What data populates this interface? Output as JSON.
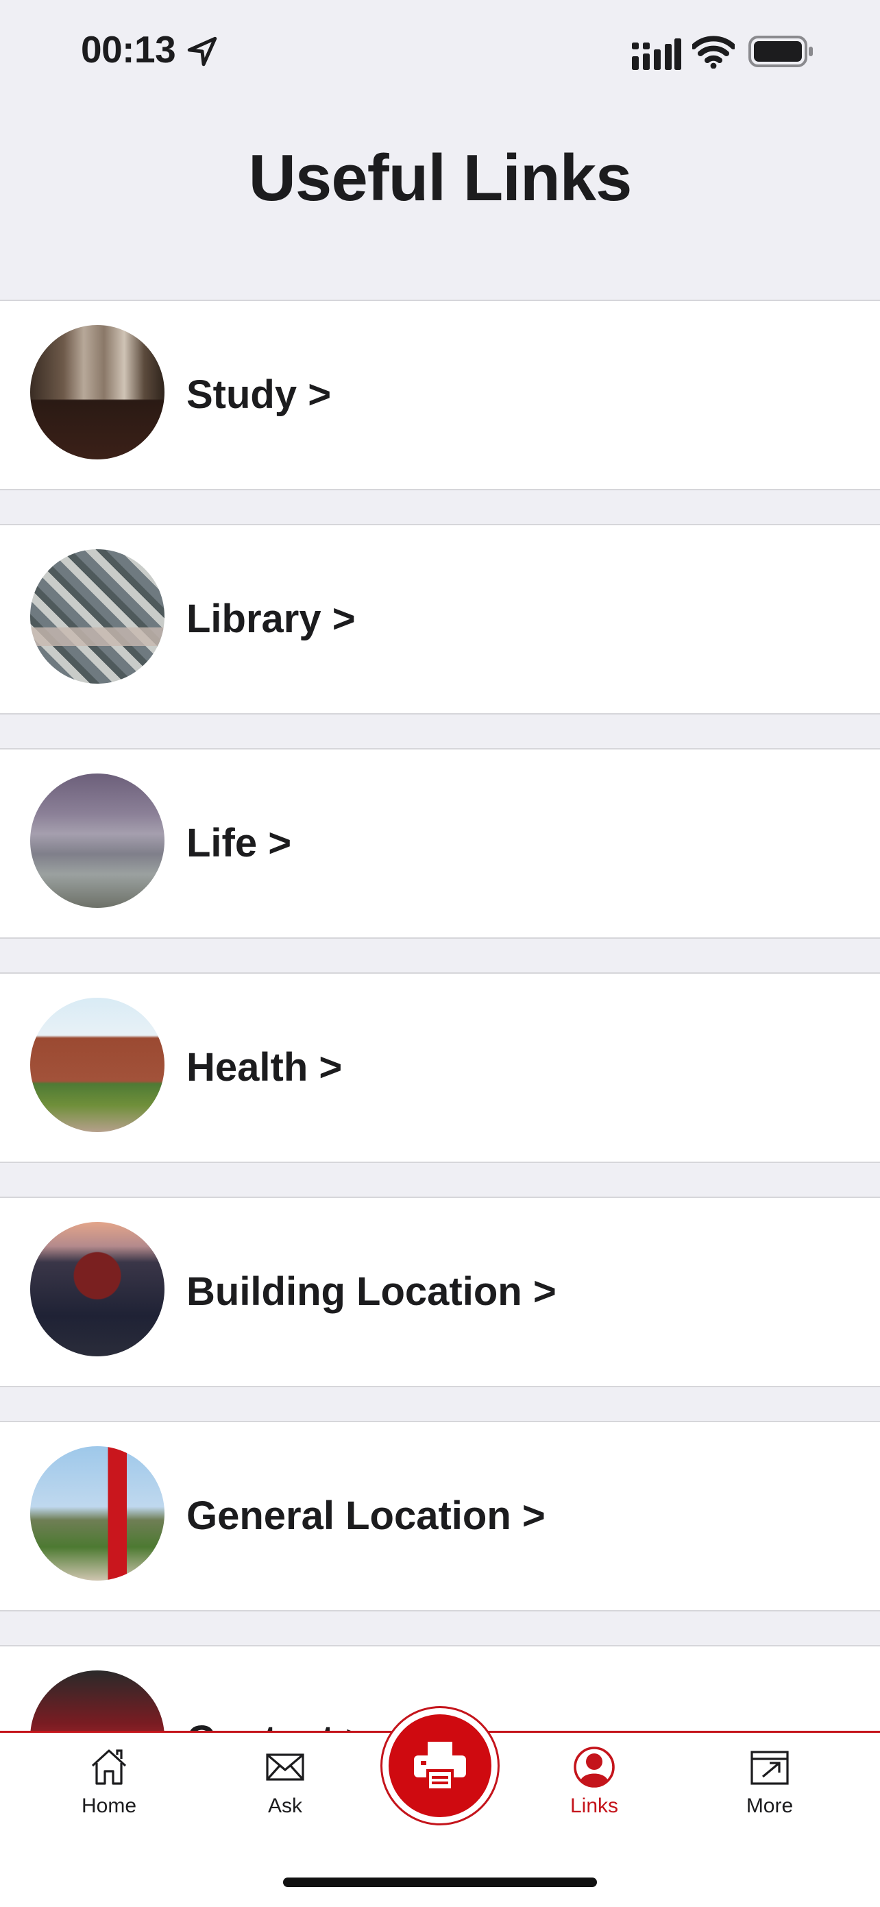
{
  "status": {
    "time": "00:13"
  },
  "page": {
    "title": "Useful Links"
  },
  "links": [
    {
      "label": "Study >",
      "thumb": "study-photo"
    },
    {
      "label": "Library >",
      "thumb": "library-aerial-photo"
    },
    {
      "label": "Life >",
      "thumb": "campus-life-photo"
    },
    {
      "label": "Health >",
      "thumb": "health-building-photo"
    },
    {
      "label": "Building Location >",
      "thumb": "tower-building-photo"
    },
    {
      "label": "General Location >",
      "thumb": "campus-sign-photo"
    },
    {
      "label": "Contact >",
      "thumb": "contact-photo"
    }
  ],
  "tabbar": {
    "home": "Home",
    "ask": "Ask",
    "links": "Links",
    "more": "More",
    "center_icon": "printer-icon",
    "accent": "#C4141B"
  }
}
